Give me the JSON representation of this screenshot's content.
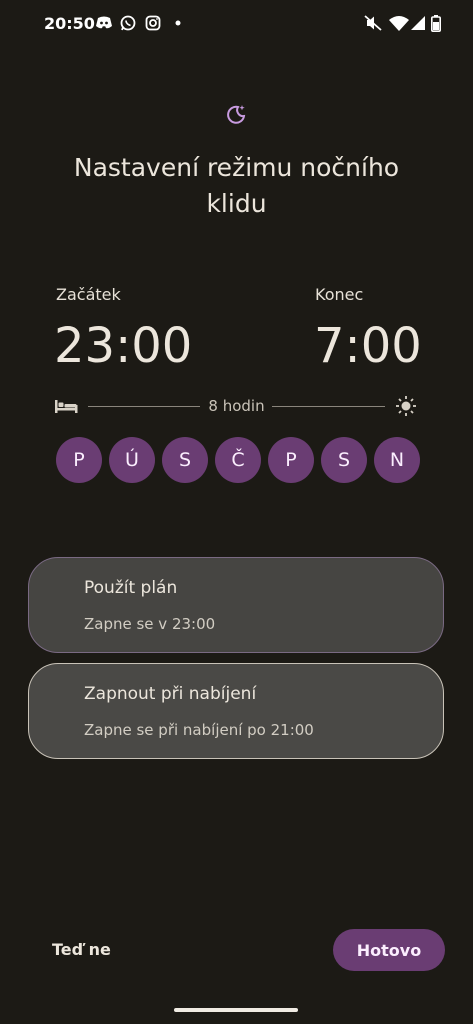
{
  "status_bar": {
    "time": "20:50",
    "icons": [
      "discord-icon",
      "whatsapp-icon",
      "instagram-icon",
      "dot-icon",
      "mute-icon",
      "wifi-icon",
      "signal-icon",
      "battery-icon"
    ]
  },
  "header": {
    "icon": "bedtime-moon-icon",
    "title": "Nastavení režimu nočního klidu"
  },
  "schedule": {
    "start_label": "Začátek",
    "start_time": "23:00",
    "end_label": "Konec",
    "end_time": "7:00",
    "duration": "8 hodin"
  },
  "days": [
    "P",
    "Ú",
    "S",
    "Č",
    "P",
    "S",
    "N"
  ],
  "options": [
    {
      "title": "Použít plán",
      "subtitle": "Zapne se v 23:00"
    },
    {
      "title": "Zapnout při nabíjení",
      "subtitle": "Zapne se při nabíjení po 21:00"
    }
  ],
  "footer": {
    "not_now": "Teď ne",
    "done": "Hotovo"
  },
  "colors": {
    "background": "#1c1a15",
    "accent": "#6a3d73",
    "card": "#464542"
  }
}
